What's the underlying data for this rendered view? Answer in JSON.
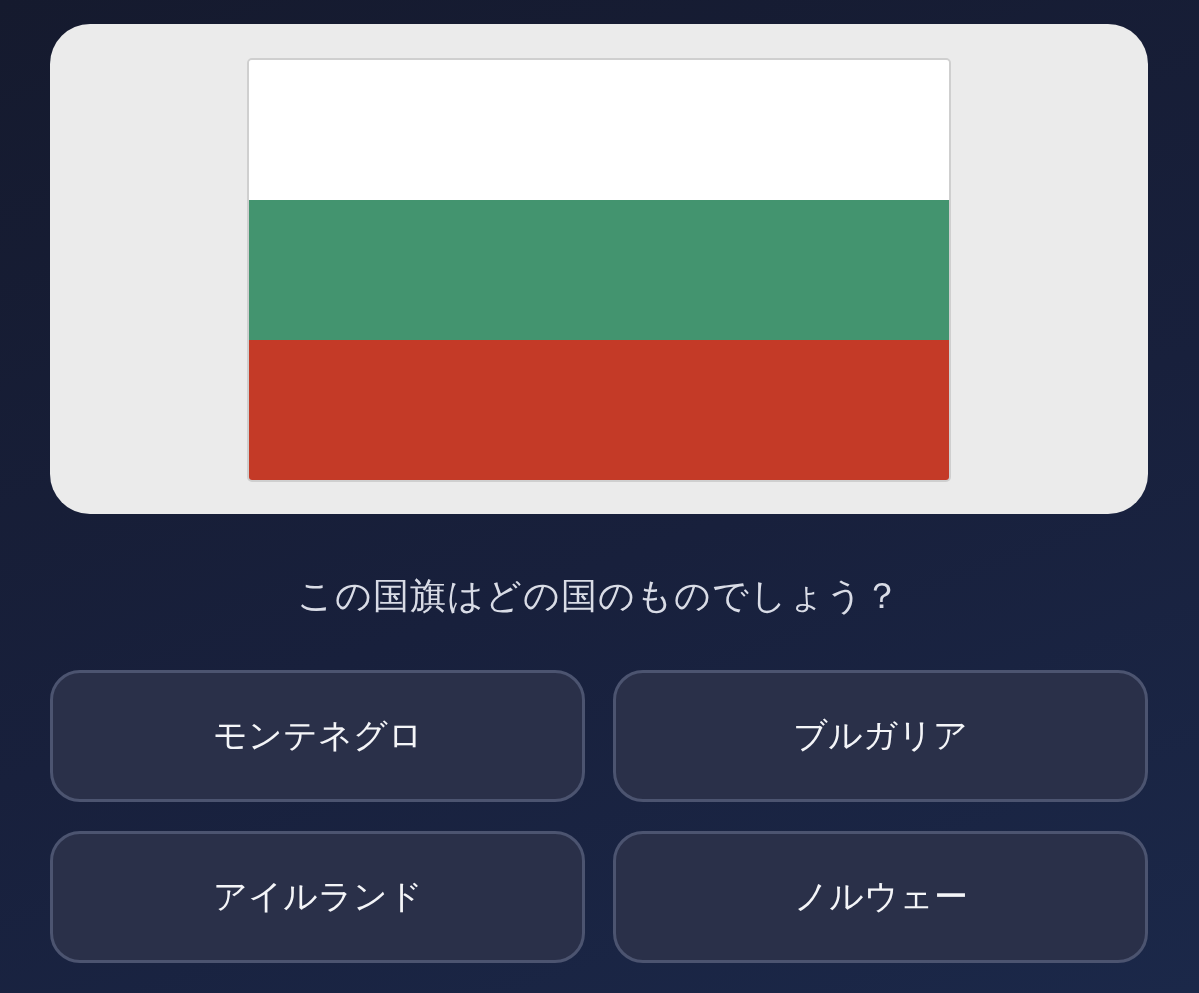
{
  "flag": {
    "stripes": [
      {
        "color": "#ffffff"
      },
      {
        "color": "#43946f"
      },
      {
        "color": "#c43a27"
      }
    ]
  },
  "question": "この国旗はどの国のものでしょう？",
  "options": [
    {
      "label": "モンテネグロ",
      "selected": false
    },
    {
      "label": "ブルガリア",
      "selected": false
    },
    {
      "label": "アイルランド",
      "selected": false
    },
    {
      "label": "ノルウェー",
      "selected": false
    }
  ]
}
